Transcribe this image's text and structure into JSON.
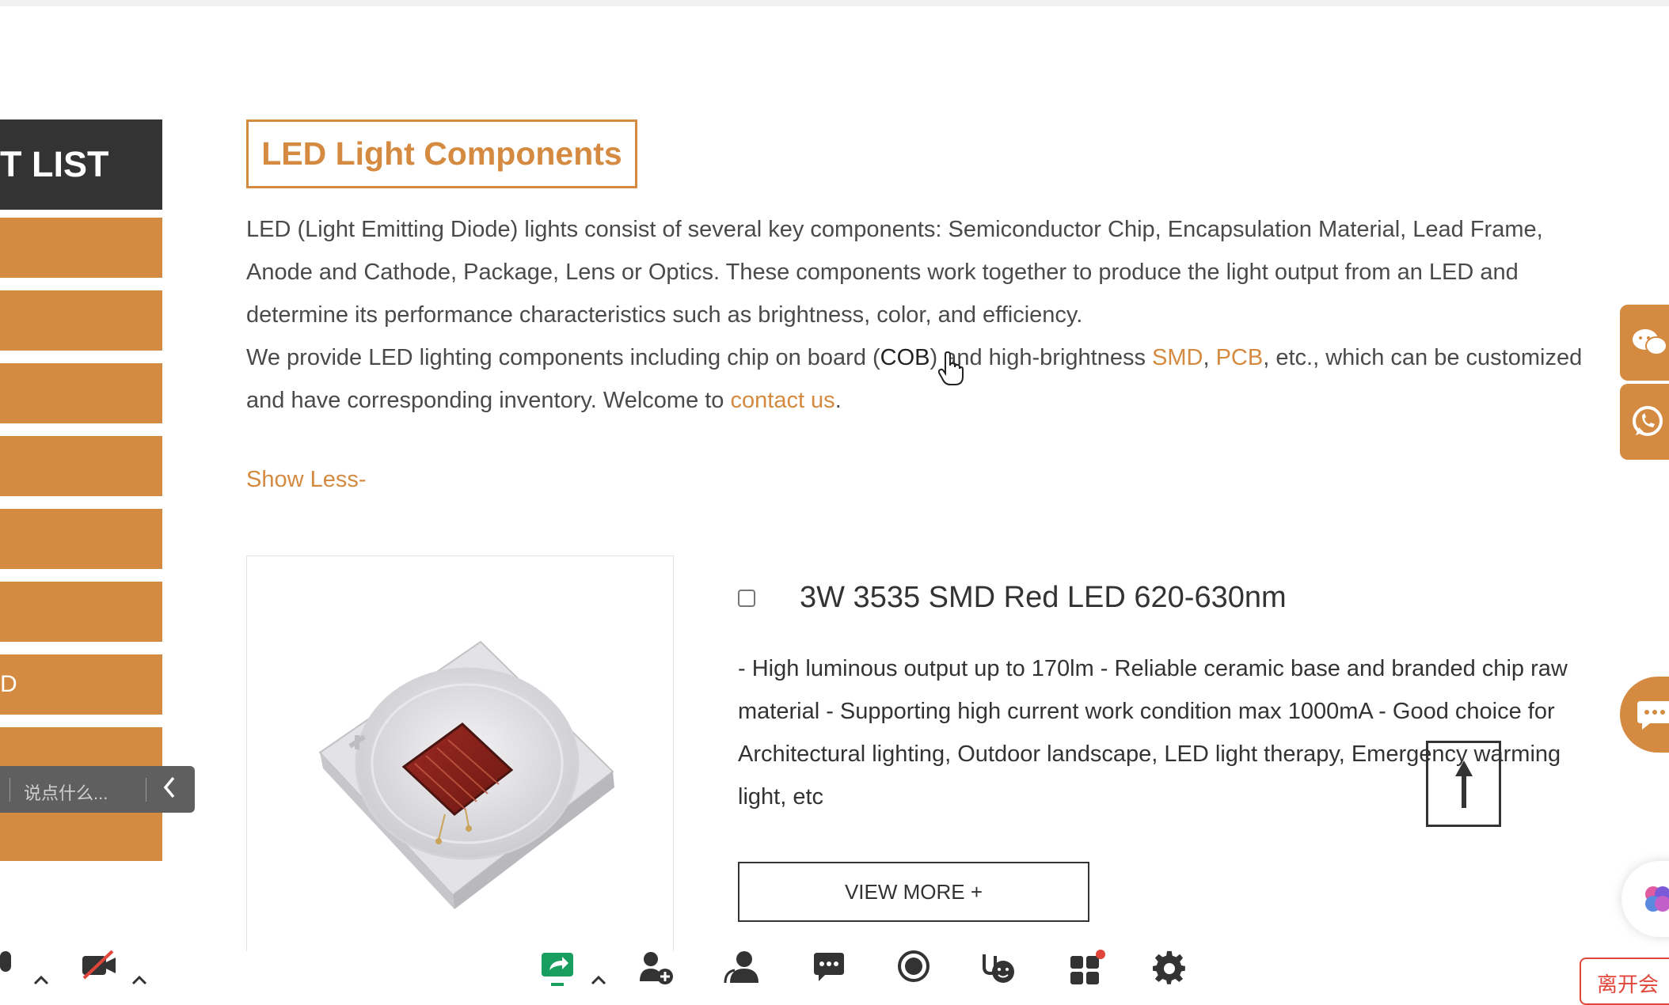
{
  "sidebar": {
    "header": "T LIST",
    "items": [
      {
        "label": ""
      },
      {
        "label": ""
      },
      {
        "label": ""
      },
      {
        "label": ""
      },
      {
        "label": ""
      },
      {
        "label": ""
      },
      {
        "label": "D"
      },
      {
        "label": ""
      },
      {
        "label": ""
      }
    ]
  },
  "chat_overlay": {
    "placeholder": "说点什么..."
  },
  "main": {
    "title": "LED Light Components",
    "desc_line1": "LED (Light Emitting Diode) lights consist of several key components: Semiconductor Chip, Encapsulation Material, Lead Frame, Anode and Cathode, Package, Lens or Optics. These components work together to produce the light output from an LED and determine its performance characteristics such as brightness, color, and efficiency.",
    "desc2_a": "We provide LED lighting components including chip on board (",
    "desc2_cob": "COB",
    "desc2_b": ") and high-brightness ",
    "link_smd": "SMD",
    "comma": ", ",
    "link_pcb": "PCB",
    "desc2_c": ", etc., which can be customized and have corresponding inventory. Welcome to ",
    "link_contact": "contact us",
    "period": ".",
    "show_less": "Show Less-"
  },
  "product": {
    "title": "3W 3535 SMD Red LED 620-630nm",
    "description": "- High luminous output up to 170lm - Reliable ceramic base and branded chip raw material - Supporting high current work condition max 1000mA - Good choice for Architectural lighting, Outdoor landscape, LED light therapy, Emergency warming light, etc",
    "view_more": "VIEW MORE +"
  },
  "toolbar": {
    "leave_label": "离开会"
  },
  "colors": {
    "accent": "#d48a40",
    "dark": "#333333",
    "leave": "#e0463a"
  }
}
